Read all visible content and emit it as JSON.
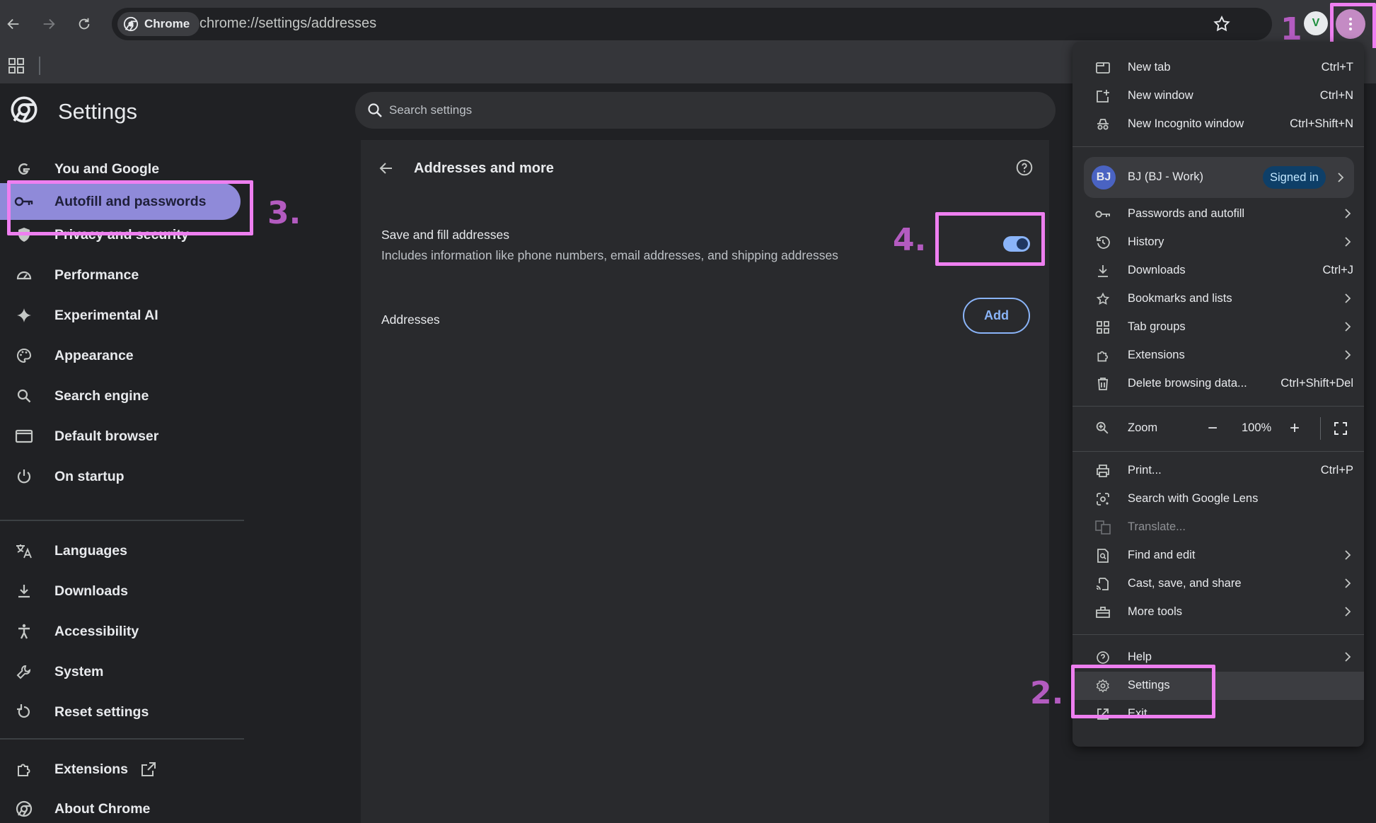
{
  "browser": {
    "chip_label": "Chrome",
    "url": "chrome://settings/addresses",
    "avatar_initial": "V",
    "accent_color": "#8ab4f8"
  },
  "header": {
    "title": "Settings",
    "search_placeholder": "Search settings"
  },
  "sidebar": {
    "items": [
      {
        "label": "You and Google",
        "icon": "google-g-icon"
      },
      {
        "label": "Autofill and passwords",
        "icon": "key-icon",
        "active": true
      },
      {
        "label": "Privacy and security",
        "icon": "shield-icon"
      },
      {
        "label": "Performance",
        "icon": "speedometer-icon"
      },
      {
        "label": "Experimental AI",
        "icon": "sparkle-icon"
      },
      {
        "label": "Appearance",
        "icon": "palette-icon"
      },
      {
        "label": "Search engine",
        "icon": "search-icon"
      },
      {
        "label": "Default browser",
        "icon": "browser-window-icon"
      },
      {
        "label": "On startup",
        "icon": "power-icon"
      },
      {
        "label": "Languages",
        "icon": "translate-icon"
      },
      {
        "label": "Downloads",
        "icon": "download-icon"
      },
      {
        "label": "Accessibility",
        "icon": "accessibility-icon"
      },
      {
        "label": "System",
        "icon": "wrench-icon"
      },
      {
        "label": "Reset settings",
        "icon": "reset-icon"
      },
      {
        "label": "Extensions",
        "icon": "puzzle-icon"
      },
      {
        "label": "About Chrome",
        "icon": "chrome-logo-icon"
      }
    ]
  },
  "main": {
    "title": "Addresses and more",
    "save_fill_title": "Save and fill addresses",
    "save_fill_desc": "Includes information like phone numbers, email addresses, and shipping addresses",
    "save_fill_enabled": true,
    "addresses_label": "Addresses",
    "add_label": "Add"
  },
  "menu": {
    "new_tab": {
      "label": "New tab",
      "shortcut": "Ctrl+T"
    },
    "new_window": {
      "label": "New window",
      "shortcut": "Ctrl+N"
    },
    "incognito": {
      "label": "New Incognito window",
      "shortcut": "Ctrl+Shift+N"
    },
    "profile": {
      "initials": "BJ",
      "name": "BJ (BJ - Work)",
      "status": "Signed in"
    },
    "passwords": {
      "label": "Passwords and autofill"
    },
    "history": {
      "label": "History"
    },
    "downloads": {
      "label": "Downloads",
      "shortcut": "Ctrl+J"
    },
    "bookmarks": {
      "label": "Bookmarks and lists"
    },
    "tab_groups": {
      "label": "Tab groups"
    },
    "extensions": {
      "label": "Extensions"
    },
    "delete_data": {
      "label": "Delete browsing data...",
      "shortcut": "Ctrl+Shift+Del"
    },
    "zoom": {
      "label": "Zoom",
      "value": "100%",
      "minus": "−",
      "plus": "+"
    },
    "print": {
      "label": "Print...",
      "shortcut": "Ctrl+P"
    },
    "lens": {
      "label": "Search with Google Lens"
    },
    "translate": {
      "label": "Translate..."
    },
    "find_edit": {
      "label": "Find and edit"
    },
    "cast": {
      "label": "Cast, save, and share"
    },
    "more_tools": {
      "label": "More tools"
    },
    "help": {
      "label": "Help"
    },
    "settings": {
      "label": "Settings"
    },
    "exit": {
      "label": "Exit"
    }
  },
  "annotations": {
    "step1": "1",
    "step2": "2.",
    "step3": "3.",
    "step4": "4.",
    "highlight_color": "#ee7ff0",
    "label_color": "#b35bc0"
  }
}
